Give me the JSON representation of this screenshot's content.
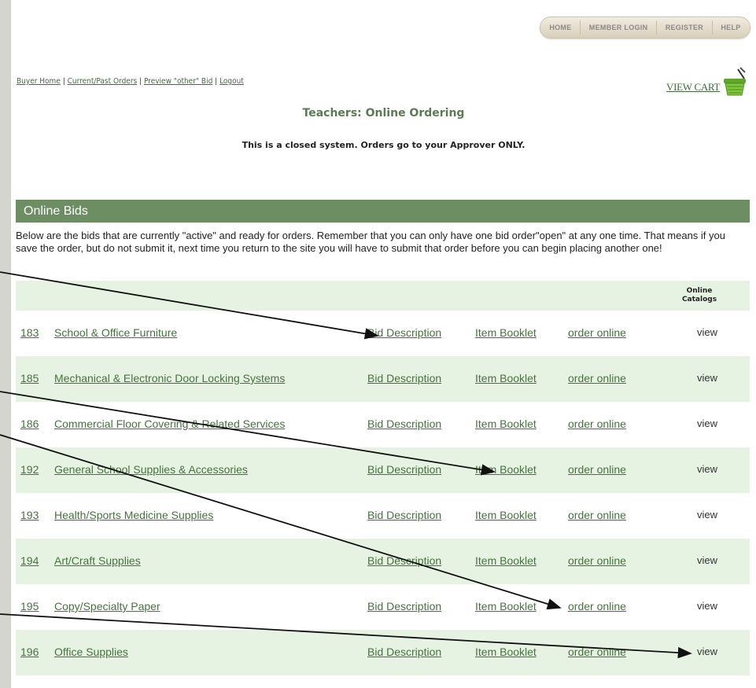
{
  "top_nav": [
    {
      "label": "HOME"
    },
    {
      "label": "MEMBER LOGIN"
    },
    {
      "label": "REGISTER"
    },
    {
      "label": "HELP"
    }
  ],
  "breadcrumbs": [
    {
      "label": "Buyer Home"
    },
    {
      "label": "Current/Past Orders"
    },
    {
      "label": "Preview \"other\" Bid"
    },
    {
      "label": "Logout"
    }
  ],
  "breadcrumb_separator": "|",
  "cart": {
    "label": "VIEW CART",
    "icon": "shopping-basket-icon"
  },
  "page_title": "Teachers: Online Ordering",
  "notice": "This is a closed system. Orders go to your Approver ONLY.",
  "section": {
    "title": "Online Bids",
    "intro": "Below are the bids that are currently \"active\" and ready for orders. Remember that you can only have one bid order\"open\" at any one time. That means if you save the order, but do not submit it, next time you return to the site you will have to submit that order before you can begin placing another one!"
  },
  "table": {
    "catalog_header_line1": "Online",
    "catalog_header_line2": "Catalogs",
    "rows": [
      {
        "number": "183",
        "name": "School & Office Furniture",
        "desc": "Bid Description",
        "booklet": "Item Booklet",
        "order": "order online",
        "view": "view"
      },
      {
        "number": "185",
        "name": "Mechanical & Electronic Door Locking Systems",
        "desc": "Bid Description",
        "booklet": "Item Booklet",
        "order": "order online",
        "view": "view"
      },
      {
        "number": "186",
        "name": "Commercial Floor Covering & Related Services",
        "desc": "Bid Description",
        "booklet": "Item Booklet",
        "order": "order online",
        "view": "view"
      },
      {
        "number": "192",
        "name": "General School Supplies & Accessories",
        "desc": "Bid Description",
        "booklet": "Item Booklet",
        "order": "order online",
        "view": "view"
      },
      {
        "number": "193",
        "name": "Health/Sports Medicine Supplies",
        "desc": "Bid Description",
        "booklet": "Item Booklet",
        "order": "order online",
        "view": "view"
      },
      {
        "number": "194",
        "name": "Art/Craft Supplies",
        "desc": "Bid Description",
        "booklet": "Item Booklet",
        "order": "order online",
        "view": "view"
      },
      {
        "number": "195",
        "name": "Copy/Specialty Paper",
        "desc": "Bid Description",
        "booklet": "Item Booklet",
        "order": "order online",
        "view": "view"
      },
      {
        "number": "196",
        "name": "Office Supplies",
        "desc": "Bid Description",
        "booklet": "Item Booklet",
        "order": "order online",
        "view": "view"
      }
    ]
  },
  "colors": {
    "header_green": "#6c8e62",
    "link_green": "#43753b",
    "row_alt": "#e7f3e2",
    "title_green": "#5b7b52"
  }
}
